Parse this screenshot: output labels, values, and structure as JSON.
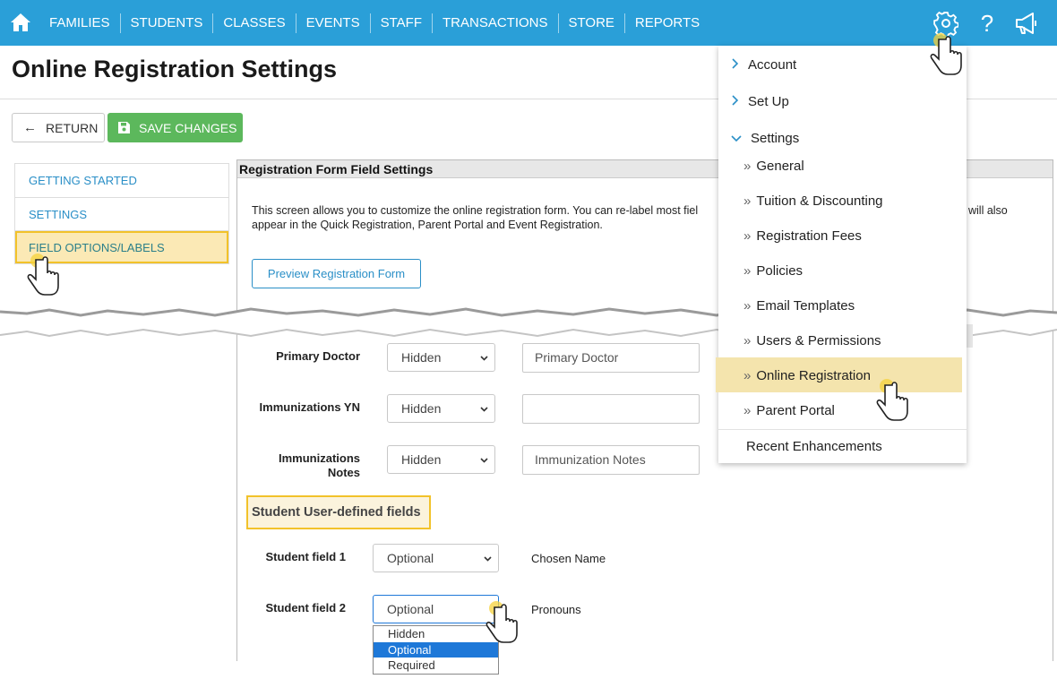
{
  "nav": {
    "items": [
      "FAMILIES",
      "STUDENTS",
      "CLASSES",
      "EVENTS",
      "STAFF",
      "TRANSACTIONS",
      "STORE",
      "REPORTS"
    ]
  },
  "page": {
    "title": "Online Registration Settings",
    "return_label": "RETURN",
    "save_label": "SAVE CHANGES"
  },
  "leftmenu": {
    "items": [
      "GETTING STARTED",
      "SETTINGS",
      "FIELD OPTIONS/LABELS"
    ],
    "active": "FIELD OPTIONS/LABELS"
  },
  "panel": {
    "title": "Registration Form Field Settings",
    "intro": "This screen allows you to customize the online registration form. You can re-label most fiel",
    "intro_right": "will also",
    "intro_line2": "appear in the Quick Registration, Parent Portal and Event Registration.",
    "preview_label": "Preview Registration Form"
  },
  "fields": [
    {
      "label": "Primary Doctor",
      "option": "Hidden",
      "text": "Primary Doctor"
    },
    {
      "label": "Immunizations YN",
      "option": "Hidden",
      "text": ""
    },
    {
      "label_line1": "Immunizations",
      "label_line2": "Notes",
      "option": "Hidden",
      "text": "Immunization Notes"
    }
  ],
  "student_fields": {
    "section_title": "Student User-defined fields",
    "rows": [
      {
        "label": "Student field 1",
        "option": "Optional",
        "name": "Chosen Name"
      },
      {
        "label": "Student field 2",
        "option": "Optional",
        "name": "Pronouns"
      }
    ],
    "dropdown_options": [
      "Hidden",
      "Optional",
      "Required"
    ],
    "dropdown_selected": "Optional"
  },
  "settings_menu": {
    "top_items": [
      "Account",
      "Set Up",
      "Settings"
    ],
    "sub_items": [
      "General",
      "Tuition & Discounting",
      "Registration Fees",
      "Policies",
      "Email Templates",
      "Users & Permissions",
      "Online Registration",
      "Parent Portal"
    ],
    "highlighted": "Online Registration",
    "footer_item": "Recent Enhancements"
  },
  "colors": {
    "nav_bg": "#2a9fd8",
    "save_green": "#5cb85c",
    "highlight_border": "#f2c22a",
    "highlight_fill": "#fbe9b5",
    "link_blue": "#2a8fc7"
  },
  "icons": [
    "home-icon",
    "gear-icon",
    "help-icon",
    "megaphone-icon",
    "arrow-left-icon",
    "save-disk-icon",
    "chevron-down-icon",
    "chevron-right-icon",
    "double-chevron-icon",
    "hand-pointer-icon"
  ]
}
